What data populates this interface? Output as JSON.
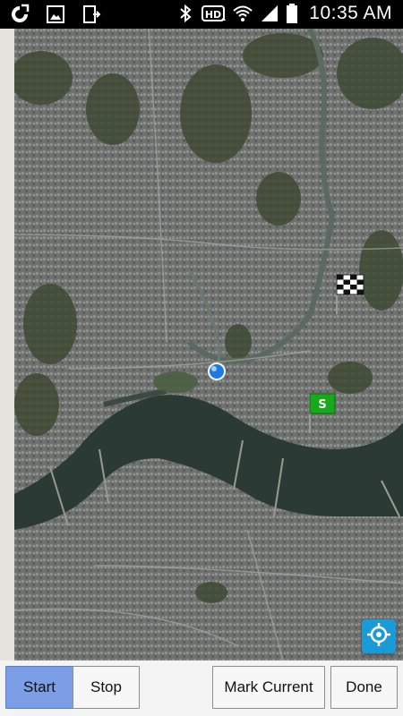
{
  "status_bar": {
    "time": "10:35 AM",
    "left_icons": [
      "app-notification-icon",
      "image-icon",
      "file-download-icon"
    ],
    "right_icons": [
      "bluetooth-icon",
      "hd-voice-icon",
      "wifi-icon",
      "signal-icon",
      "battery-icon"
    ],
    "hd_label": "HD"
  },
  "map": {
    "start_flag_label": "S",
    "markers": [
      "current-location-dot",
      "finish-flag",
      "start-flag"
    ]
  },
  "toolbar": {
    "start_label": "Start",
    "stop_label": "Stop",
    "mark_current_label": "Mark Current",
    "done_label": "Done"
  },
  "colors": {
    "active_button": "#7b9ee6",
    "location_button": "#1a9ad6",
    "start_flag": "#18a81c"
  }
}
